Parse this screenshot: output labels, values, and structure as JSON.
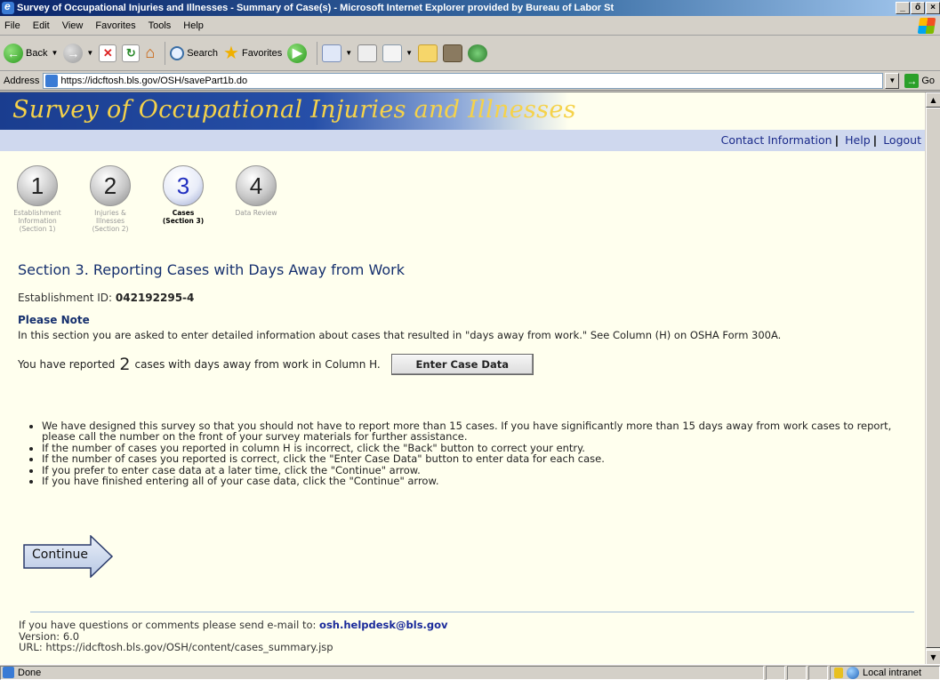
{
  "window": {
    "title": "Survey of Occupational Injuries and Illnesses - Summary of Case(s) - Microsoft Internet Explorer provided by Bureau of Labor St",
    "controls": [
      "_",
      "ő",
      "×"
    ]
  },
  "menu": [
    "File",
    "Edit",
    "View",
    "Favorites",
    "Tools",
    "Help"
  ],
  "toolbar": {
    "back_label": "Back",
    "search_label": "Search",
    "favorites_label": "Favorites"
  },
  "address": {
    "label": "Address",
    "url": "https://idcftosh.bls.gov/OSH/savePart1b.do",
    "go_label": "Go"
  },
  "page": {
    "banner_title": "Survey of Occupational Injuries and Illnesses",
    "links": [
      "Contact Information",
      "Help",
      "Logout"
    ],
    "steps": [
      {
        "number": "1",
        "label": "Establishment Information (Section 1)",
        "active": false
      },
      {
        "number": "2",
        "label": "Injuries & Illnesses (Section 2)",
        "active": false
      },
      {
        "number": "3",
        "label": "Cases (Section 3)",
        "active": true
      },
      {
        "number": "4",
        "label": "Data Review",
        "active": false
      }
    ],
    "section_heading": "Section 3. Reporting Cases with Days Away from Work",
    "establishment_id_label": "Establishment ID:",
    "establishment_id": "042192295-4",
    "note_heading": "Please Note",
    "note_text": "In this section you are asked to enter detailed information about cases that resulted in \"days away from work.\" See Column (H) on OSHA Form 300A.",
    "reported_prefix": "You have reported",
    "reported_count": "2",
    "reported_suffix": "cases with days away from work in Column H.",
    "enter_button": "Enter Case Data",
    "bullets": [
      "We have designed this survey so that you should not have to report more than 15 cases. If you have significantly more than 15 days away from work cases to report, please call the number on the front of your survey materials for further assistance.",
      "If the number of cases you reported in column H is incorrect, click the \"Back\" button to correct your entry.",
      "If the number of cases you reported is correct, click the \"Enter Case Data\" button to enter data for each case.",
      "If you prefer to enter case data at a later time, click the \"Continue\" arrow.",
      "If you have finished entering all of your case data, click the \"Continue\" arrow."
    ],
    "continue_label": "Continue",
    "footer": {
      "contact_prefix": "If you have questions or comments please send e-mail to:",
      "email": "osh.helpdesk@bls.gov",
      "version": "Version: 6.0",
      "url": "URL: https://idcftosh.bls.gov/OSH/content/cases_summary.jsp"
    }
  },
  "status": {
    "text": "Done",
    "zone": "Local intranet"
  }
}
